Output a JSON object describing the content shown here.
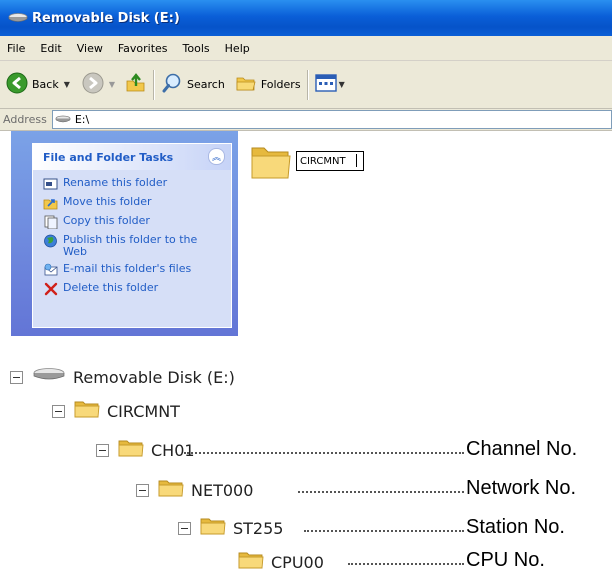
{
  "window": {
    "title": "Removable Disk (E:)",
    "menu": [
      "File",
      "Edit",
      "View",
      "Favorites",
      "Tools",
      "Help"
    ],
    "toolbar": {
      "back_label": "Back",
      "search_label": "Search",
      "folders_label": "Folders"
    },
    "address": {
      "label": "Address",
      "value": "E:\\"
    },
    "tasks": {
      "title": "File and Folder Tasks",
      "items": [
        {
          "label": "Rename this folder",
          "icon": "rename-icon"
        },
        {
          "label": "Move this folder",
          "icon": "move-icon"
        },
        {
          "label": "Copy this folder",
          "icon": "copy-icon"
        },
        {
          "label": "Publish this folder to the Web",
          "icon": "globe-icon"
        },
        {
          "label": "E-mail this folder's files",
          "icon": "email-icon"
        },
        {
          "label": "Delete this folder",
          "icon": "delete-icon"
        }
      ]
    },
    "folder": {
      "rename_value": "CIRCMNT"
    }
  },
  "tree": {
    "root": "Removable Disk (E:)",
    "nodes": [
      {
        "label": "CIRCMNT",
        "description": ""
      },
      {
        "label": "CH01",
        "description": "Channel No."
      },
      {
        "label": "NET000",
        "description": "Network No."
      },
      {
        "label": "ST255",
        "description": "Station No."
      },
      {
        "label": "CPU00",
        "description": "CPU No."
      }
    ]
  }
}
